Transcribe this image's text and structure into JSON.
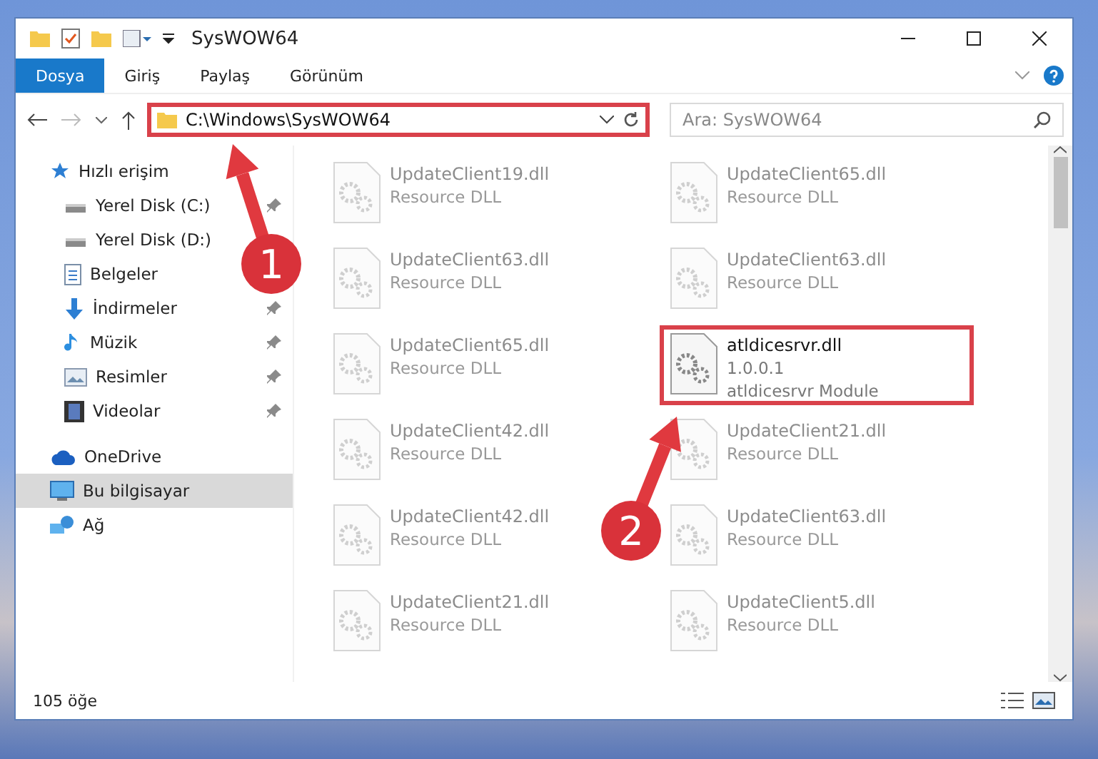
{
  "window": {
    "title": "SysWOW64"
  },
  "ribbon_tabs": [
    {
      "label": "Dosya",
      "selected": true
    },
    {
      "label": "Giriş",
      "selected": false
    },
    {
      "label": "Paylaş",
      "selected": false
    },
    {
      "label": "Görünüm",
      "selected": false
    }
  ],
  "address": {
    "value": "C:\\Windows\\SysWOW64",
    "highlighted": true
  },
  "search": {
    "placeholder": "Ara: SysWOW64"
  },
  "sidebar": {
    "items": [
      {
        "label": "Hızlı erişim",
        "kind": "star",
        "selected": false,
        "children": [
          {
            "label": "Yerel Disk (C:)",
            "kind": "drive",
            "pinned": true,
            "selected": false
          },
          {
            "label": "Yerel Disk (D:)",
            "kind": "drive",
            "pinned": false,
            "selected": false
          },
          {
            "label": "Belgeler",
            "kind": "document",
            "pinned": false,
            "selected": false
          },
          {
            "label": "İndirmeler",
            "kind": "download",
            "pinned": true,
            "selected": false
          },
          {
            "label": "Müzik",
            "kind": "music",
            "pinned": true,
            "selected": false
          },
          {
            "label": "Resimler",
            "kind": "pictures",
            "pinned": true,
            "selected": false
          },
          {
            "label": "Videolar",
            "kind": "video",
            "pinned": true,
            "selected": false
          }
        ]
      },
      {
        "label": "OneDrive",
        "kind": "cloud",
        "selected": false
      },
      {
        "label": "Bu bilgisayar",
        "kind": "computer",
        "selected": true
      },
      {
        "label": "Ağ",
        "kind": "network",
        "selected": false
      }
    ]
  },
  "files": [
    {
      "name": "UpdateClient19.dll",
      "lines": [
        "Resource DLL"
      ],
      "faded": true,
      "highlighted": false
    },
    {
      "name": "UpdateClient65.dll",
      "lines": [
        "Resource DLL"
      ],
      "faded": true,
      "highlighted": false
    },
    {
      "name": "UpdateClient63.dll",
      "lines": [
        "Resource DLL"
      ],
      "faded": true,
      "highlighted": false
    },
    {
      "name": "UpdateClient63.dll",
      "lines": [
        "Resource DLL"
      ],
      "faded": true,
      "highlighted": false
    },
    {
      "name": "UpdateClient65.dll",
      "lines": [
        "Resource DLL"
      ],
      "faded": true,
      "highlighted": false
    },
    {
      "name": "atldicesrvr.dll",
      "lines": [
        "1.0.0.1",
        "atldicesrvr Module"
      ],
      "faded": false,
      "highlighted": true
    },
    {
      "name": "UpdateClient42.dll",
      "lines": [
        "Resource DLL"
      ],
      "faded": true,
      "highlighted": false
    },
    {
      "name": "UpdateClient21.dll",
      "lines": [
        "Resource DLL"
      ],
      "faded": true,
      "highlighted": false
    },
    {
      "name": "UpdateClient42.dll",
      "lines": [
        "Resource DLL"
      ],
      "faded": true,
      "highlighted": false
    },
    {
      "name": "UpdateClient63.dll",
      "lines": [
        "Resource DLL"
      ],
      "faded": true,
      "highlighted": false
    },
    {
      "name": "UpdateClient21.dll",
      "lines": [
        "Resource DLL"
      ],
      "faded": true,
      "highlighted": false
    },
    {
      "name": "UpdateClient5.dll",
      "lines": [
        "Resource DLL"
      ],
      "faded": true,
      "highlighted": false
    }
  ],
  "status_bar": {
    "count": "105 öğe"
  },
  "annotations": [
    {
      "number": "1"
    },
    {
      "number": "2"
    }
  ]
}
